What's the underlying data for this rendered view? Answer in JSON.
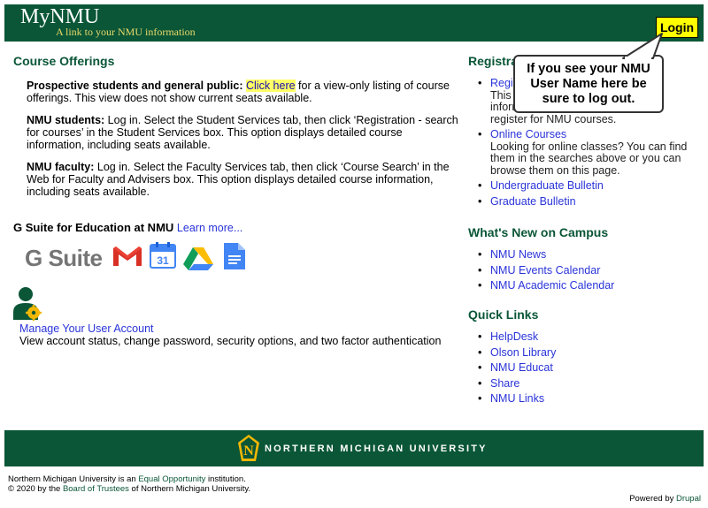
{
  "header": {
    "title": "MyNMU",
    "subtitle": "A link to your NMU information",
    "login_label": "Login"
  },
  "callout": {
    "text": "If you see your NMU User Name here be sure to log out."
  },
  "course": {
    "heading": "Course Offerings",
    "p1_bold": "Prospective students and general public:",
    "p1_link": "Click here",
    "p1_text": " for a view-only listing of course offerings. This view does not show current seats available.",
    "p2_bold": "NMU students:",
    "p2_text": " Log in. Select the Student Services tab, then click ‘Registration - search for courses’ in the Student Services box. This option displays detailed course information, including seats available.",
    "p3_bold": "NMU faculty:",
    "p3_text": " Log in. Select the Faculty Services tab, then click ‘Course Search’ in the Web for Faculty and Advisers box. This option displays detailed course information, including seats available."
  },
  "gsuite": {
    "heading": "G Suite for Education at NMU",
    "learn_more": "Learn more...",
    "logo_text": "G Suite",
    "calendar_day": "31"
  },
  "account": {
    "link": "Manage Your User Account",
    "desc": "View account status, change password, security options, and two factor authentication"
  },
  "registration": {
    "heading": "Registra",
    "item1_link": "Regis",
    "item1_desc1": "This p",
    "item1_desc2": "inform",
    "item1_desc3": "register for NMU courses.",
    "online_link": "Online Courses",
    "online_desc": "Looking for online classes? You can find them in the searches above or you can browse them on this page.",
    "undergrad": "Undergraduate Bulletin",
    "graduate": "Graduate Bulletin"
  },
  "whats_new": {
    "heading": "What's New on Campus",
    "items": [
      "NMU News",
      "NMU Events Calendar",
      "NMU Academic Calendar"
    ]
  },
  "quick_links": {
    "heading": "Quick Links",
    "items": [
      "HelpDesk",
      "Olson Library",
      "NMU Educat",
      "Share",
      "NMU Links"
    ]
  },
  "footer": {
    "university": "NORTHERN MICHIGAN UNIVERSITY",
    "seal_letter": "N",
    "line1_pre": "Northern Michigan University is an ",
    "line1_link": "Equal Opportunity",
    "line1_post": " institution.",
    "line2_pre": "© 2020 by the ",
    "line2_link": "Board of Trustees",
    "line2_post": " of Northern Michigan University.",
    "powered_pre": "Powered by ",
    "powered_link": "Drupal"
  },
  "colors": {
    "brand_green": "#0a5637",
    "highlight_yellow": "#ffff00",
    "link_blue": "#1a0dab"
  },
  "icons": [
    "gmail-icon",
    "google-calendar-icon",
    "google-drive-icon",
    "google-docs-icon",
    "user-settings-icon",
    "nmu-seal-icon"
  ]
}
